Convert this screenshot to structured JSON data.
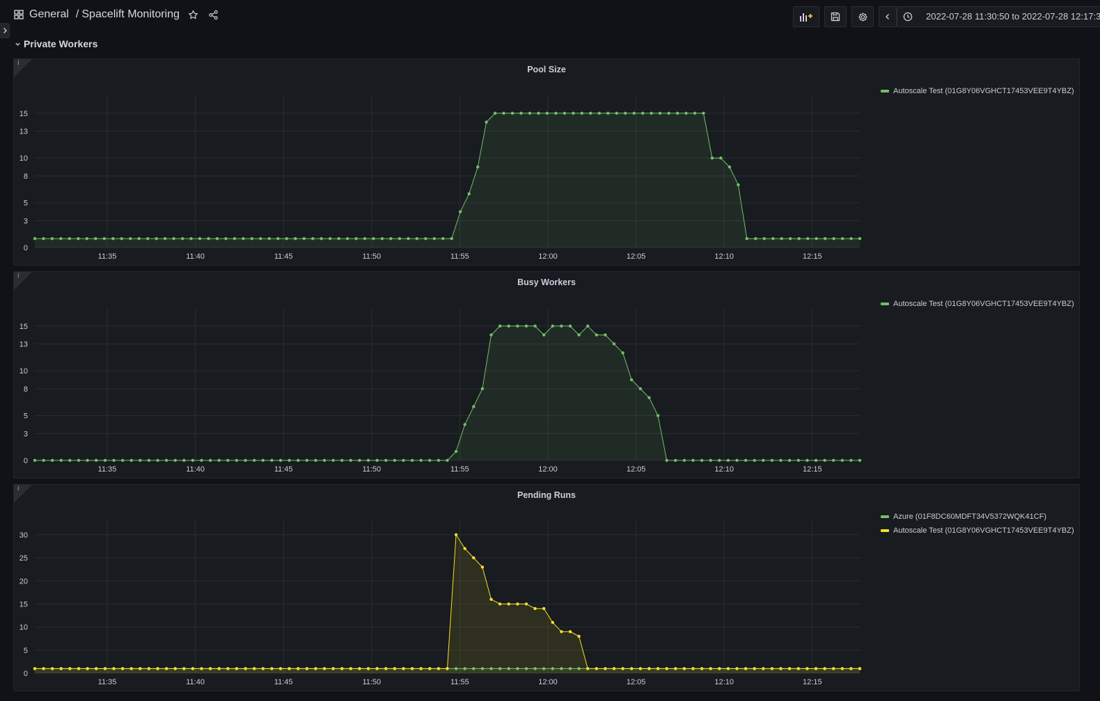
{
  "header": {
    "folder": "General",
    "separator": "/",
    "dashboard": "Spacelift Monitoring",
    "time_range": "2022-07-28 11:30:50 to 2022-07-28 12:17:3"
  },
  "row": {
    "title": "Private Workers"
  },
  "colors": {
    "green": "#73bf69",
    "yellow": "#fade2a"
  },
  "chart_data": [
    {
      "type": "line",
      "title": "Pool Size",
      "x_ticks": [
        "11:35",
        "11:40",
        "11:45",
        "11:50",
        "11:55",
        "12:00",
        "12:05",
        "12:10",
        "12:15"
      ],
      "y_ticks": [
        "0",
        "3",
        "5",
        "8",
        "10",
        "13",
        "15"
      ],
      "ylim": [
        0,
        17
      ],
      "series": [
        {
          "name": "Autoscale Test (01G8Y06VGHCT17453VEE9T4YBZ)",
          "color": "#73bf69",
          "values": [
            1,
            1,
            1,
            1,
            1,
            1,
            1,
            1,
            1,
            1,
            1,
            1,
            1,
            1,
            1,
            1,
            1,
            1,
            1,
            1,
            1,
            1,
            1,
            1,
            1,
            1,
            1,
            1,
            1,
            1,
            1,
            1,
            1,
            1,
            1,
            1,
            1,
            1,
            1,
            1,
            1,
            1,
            1,
            1,
            1,
            1,
            1,
            1,
            1,
            4,
            6,
            9,
            14,
            15,
            15,
            15,
            15,
            15,
            15,
            15,
            15,
            15,
            15,
            15,
            15,
            15,
            15,
            15,
            15,
            15,
            15,
            15,
            15,
            15,
            15,
            15,
            15,
            15,
            10,
            10,
            9,
            7,
            1,
            1,
            1,
            1,
            1,
            1,
            1,
            1,
            1,
            1,
            1,
            1,
            1,
            1
          ]
        }
      ]
    },
    {
      "type": "line",
      "title": "Busy Workers",
      "x_ticks": [
        "11:35",
        "11:40",
        "11:45",
        "11:50",
        "11:55",
        "12:00",
        "12:05",
        "12:10",
        "12:15"
      ],
      "y_ticks": [
        "0",
        "3",
        "5",
        "8",
        "10",
        "13",
        "15"
      ],
      "ylim": [
        0,
        17
      ],
      "series": [
        {
          "name": "Autoscale Test (01G8Y06VGHCT17453VEE9T4YBZ)",
          "color": "#73bf69",
          "values": [
            0,
            0,
            0,
            0,
            0,
            0,
            0,
            0,
            0,
            0,
            0,
            0,
            0,
            0,
            0,
            0,
            0,
            0,
            0,
            0,
            0,
            0,
            0,
            0,
            0,
            0,
            0,
            0,
            0,
            0,
            0,
            0,
            0,
            0,
            0,
            0,
            0,
            0,
            0,
            0,
            0,
            0,
            0,
            0,
            0,
            0,
            0,
            0,
            1,
            4,
            6,
            8,
            14,
            15,
            15,
            15,
            15,
            15,
            14,
            15,
            15,
            15,
            14,
            15,
            14,
            14,
            13,
            12,
            9,
            8,
            7,
            5,
            0,
            0,
            0,
            0,
            0,
            0,
            0,
            0,
            0,
            0,
            0,
            0,
            0,
            0,
            0,
            0,
            0,
            0,
            0,
            0,
            0,
            0,
            0
          ]
        }
      ]
    },
    {
      "type": "line",
      "title": "Pending Runs",
      "x_ticks": [
        "11:35",
        "11:40",
        "11:45",
        "11:50",
        "11:55",
        "12:00",
        "12:05",
        "12:10",
        "12:15"
      ],
      "y_ticks": [
        "0",
        "5",
        "10",
        "15",
        "20",
        "25",
        "30"
      ],
      "ylim": [
        0,
        33
      ],
      "series": [
        {
          "name": "Azure (01F8DC60MDFT34V5372WQK41CF)",
          "color": "#73bf69",
          "values": [
            1,
            1,
            1,
            1,
            1,
            1,
            1,
            1,
            1,
            1,
            1,
            1,
            1,
            1,
            1,
            1,
            1,
            1,
            1,
            1,
            1,
            1,
            1,
            1,
            1,
            1,
            1,
            1,
            1,
            1,
            1,
            1,
            1,
            1,
            1,
            1,
            1,
            1,
            1,
            1,
            1,
            1,
            1,
            1,
            1,
            1,
            1,
            1,
            1,
            1,
            1,
            1,
            1,
            1,
            1,
            1,
            1,
            1,
            1,
            1,
            1,
            1,
            1,
            1,
            1,
            1,
            1,
            1,
            1,
            1,
            1,
            1,
            1,
            1,
            1,
            1,
            1,
            1,
            1,
            1,
            1,
            1,
            1,
            1,
            1,
            1,
            1,
            1,
            1,
            1,
            1,
            1,
            1,
            1,
            1
          ]
        },
        {
          "name": "Autoscale Test (01G8Y06VGHCT17453VEE9T4YBZ)",
          "color": "#fade2a",
          "values": [
            1,
            1,
            1,
            1,
            1,
            1,
            1,
            1,
            1,
            1,
            1,
            1,
            1,
            1,
            1,
            1,
            1,
            1,
            1,
            1,
            1,
            1,
            1,
            1,
            1,
            1,
            1,
            1,
            1,
            1,
            1,
            1,
            1,
            1,
            1,
            1,
            1,
            1,
            1,
            1,
            1,
            1,
            1,
            1,
            1,
            1,
            1,
            1,
            30,
            27,
            25,
            23,
            16,
            15,
            15,
            15,
            15,
            14,
            14,
            11,
            9,
            9,
            8,
            1,
            1,
            1,
            1,
            1,
            1,
            1,
            1,
            1,
            1,
            1,
            1,
            1,
            1,
            1,
            1,
            1,
            1,
            1,
            1,
            1,
            1,
            1,
            1,
            1,
            1,
            1,
            1,
            1,
            1,
            1,
            1
          ]
        }
      ]
    }
  ]
}
